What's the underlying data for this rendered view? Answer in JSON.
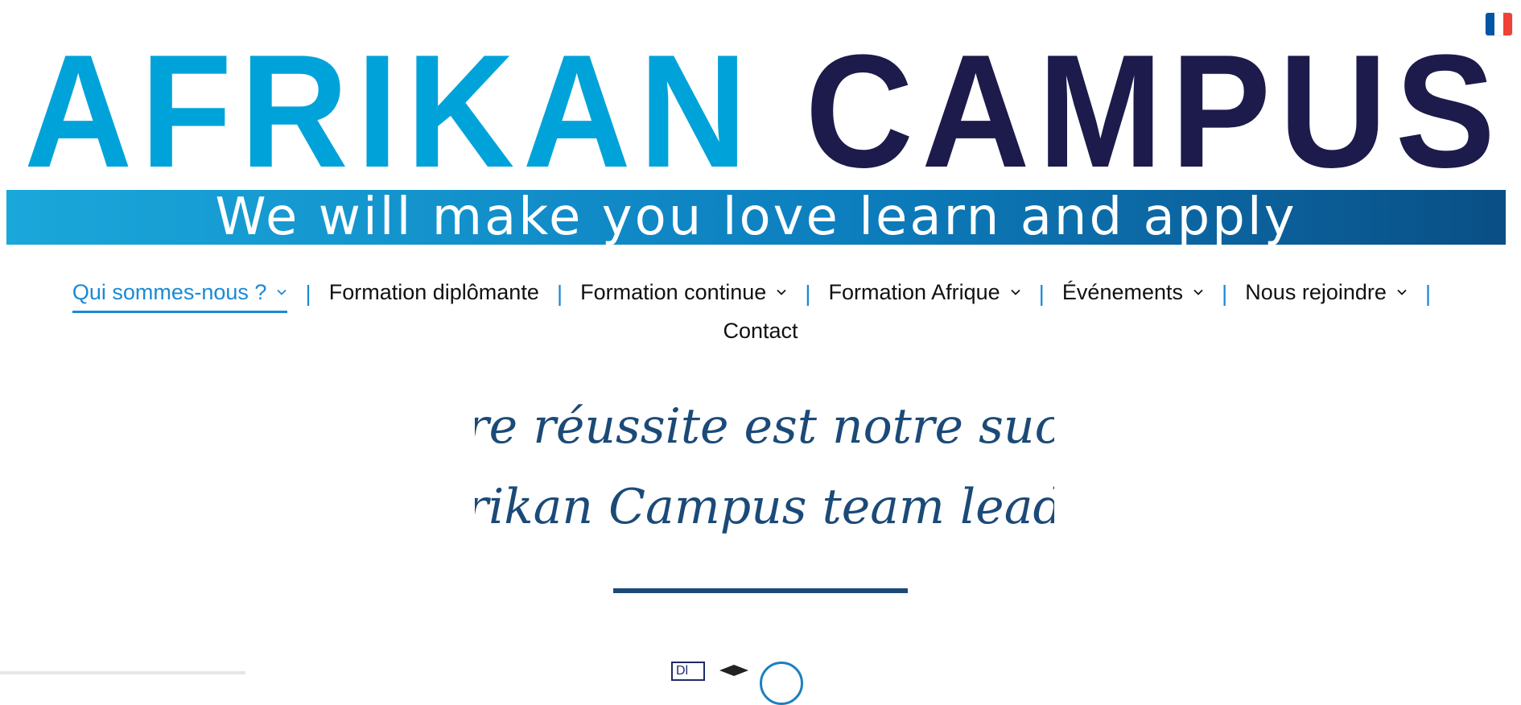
{
  "language": {
    "flag": "french-flag-icon",
    "colors": [
      "#0055a4",
      "#ffffff",
      "#ef4135"
    ]
  },
  "logo": {
    "word1": "AFRIKAN",
    "word2": "CAMPUS",
    "tagline": "We will make you love learn and apply",
    "word1_color": "#00a3d9",
    "word2_color": "#1c1b4b"
  },
  "nav": {
    "items": [
      {
        "label": "Qui sommes-nous ?",
        "dropdown": true,
        "active": true
      },
      {
        "label": "Formation diplômante",
        "dropdown": false
      },
      {
        "label": "Formation continue",
        "dropdown": true
      },
      {
        "label": "Formation Afrique",
        "dropdown": true
      },
      {
        "label": "Événements",
        "dropdown": true
      },
      {
        "label": "Nous rejoindre",
        "dropdown": true
      },
      {
        "label": "Contact",
        "dropdown": false
      }
    ],
    "separator": "|",
    "active_color": "#1a8ad4",
    "separator_color": "#1a8ad4"
  },
  "hero": {
    "line1": "Votre réussite est notre succès",
    "line2": "Afrikan Campus team leader",
    "color": "#1b4a78"
  },
  "badges": {
    "first": "Dl"
  }
}
